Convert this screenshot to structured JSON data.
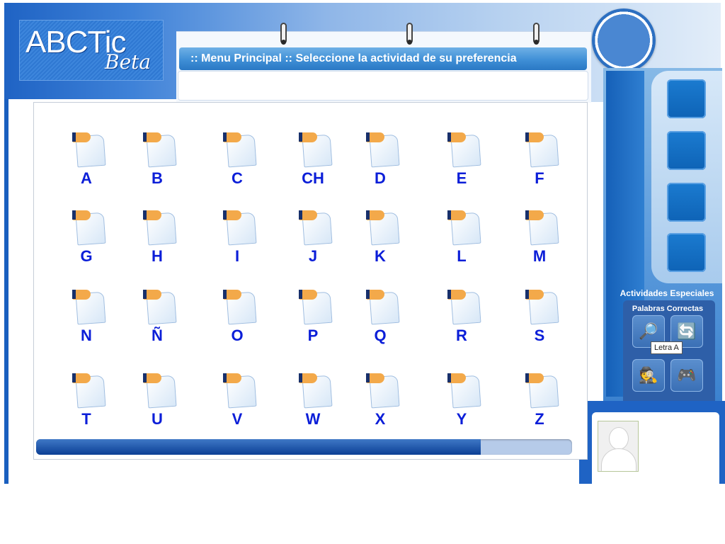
{
  "app": {
    "logo_text": "ABCTic",
    "logo_sub": "Beta"
  },
  "header": {
    "menu_title": ":: Menu Principal ::  Seleccione la actividad de su preferencia"
  },
  "letters": [
    "A",
    "B",
    "C",
    "CH",
    "D",
    "E",
    "F",
    "G",
    "H",
    "I",
    "J",
    "K",
    "L",
    "M",
    "N",
    "Ñ",
    "O",
    "P",
    "Q",
    "R",
    "S",
    "T",
    "U",
    "V",
    "W",
    "X",
    "Y",
    "Z"
  ],
  "special_activities": {
    "title": "Actividades Especiales",
    "section_label": "Palabras Correctas",
    "buttons": [
      {
        "icon": "magnifier-pencil-icon",
        "glyph": "🔎"
      },
      {
        "icon": "refresh-arrows-icon",
        "glyph": "🔄"
      },
      {
        "icon": "security-agent-icon",
        "glyph": "🕵"
      },
      {
        "icon": "gamepad-icon",
        "glyph": "🎮"
      }
    ]
  },
  "tooltip": "Letra A",
  "progress": {
    "fraction": 0.83
  },
  "colors": {
    "letter": "#0b1ed8",
    "accent": "#1f63c4"
  }
}
